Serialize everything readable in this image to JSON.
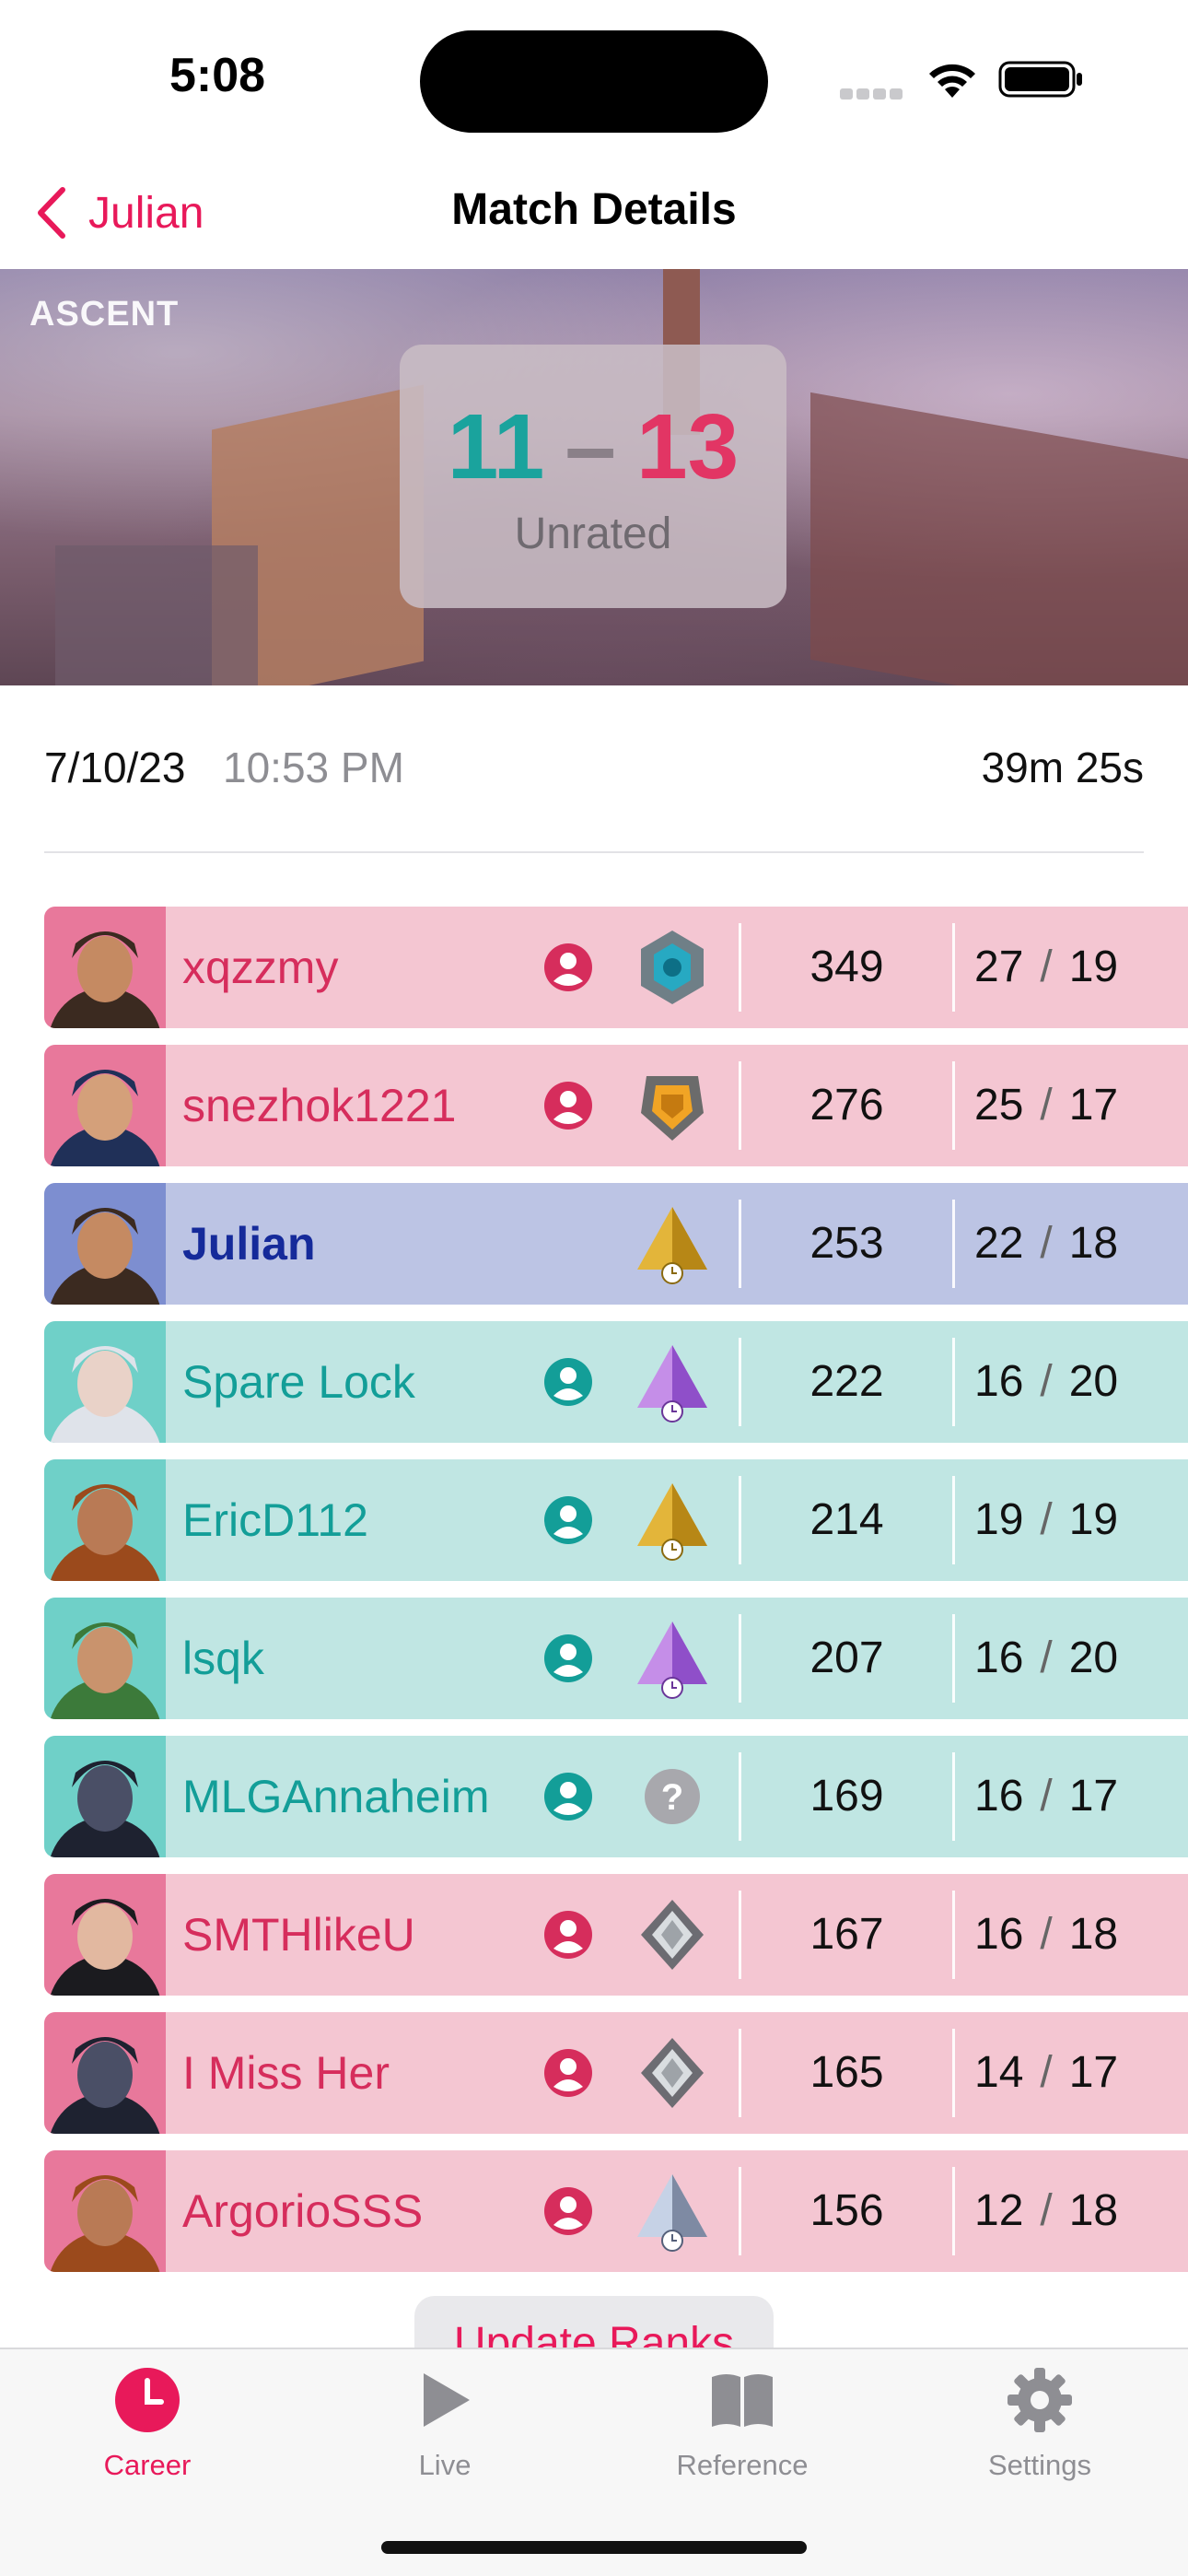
{
  "status_bar": {
    "time": "5:08"
  },
  "nav": {
    "back_label": "Julian",
    "title": "Match Details"
  },
  "hero": {
    "map_name": "ASCENT",
    "score_ally": "11",
    "score_dash": "–",
    "score_enemy": "13",
    "mode": "Unrated"
  },
  "meta": {
    "date": "7/10/23",
    "time": "10:53 PM",
    "duration": "39m 25s"
  },
  "colors": {
    "accent": "#e8195a",
    "ally": "#139e98",
    "enemy": "#d62d5c",
    "self": "#152a9a"
  },
  "players": [
    {
      "name": "xqzzmy",
      "team": "enemy",
      "rank_icon": "ascendant-rank-icon",
      "score": "349",
      "kills": "27",
      "deaths": "19",
      "profile": true
    },
    {
      "name": "snezhok1221",
      "team": "enemy",
      "rank_icon": "gold-rank-icon",
      "score": "276",
      "kills": "25",
      "deaths": "17",
      "profile": true
    },
    {
      "name": "Julian",
      "team": "self",
      "rank_icon": "gold-triangle-rank-icon",
      "score": "253",
      "kills": "22",
      "deaths": "18",
      "profile": false
    },
    {
      "name": "Spare Lock",
      "team": "ally",
      "rank_icon": "purple-triangle-rank-icon",
      "score": "222",
      "kills": "16",
      "deaths": "20",
      "profile": true
    },
    {
      "name": "EricD112",
      "team": "ally",
      "rank_icon": "gold-triangle-rank-icon",
      "score": "214",
      "kills": "19",
      "deaths": "19",
      "profile": true
    },
    {
      "name": "lsqk",
      "team": "ally",
      "rank_icon": "purple-triangle-rank-icon",
      "score": "207",
      "kills": "16",
      "deaths": "20",
      "profile": true
    },
    {
      "name": "MLGAnnaheim",
      "team": "ally",
      "rank_icon": "unknown-rank-icon",
      "score": "169",
      "kills": "16",
      "deaths": "17",
      "profile": true
    },
    {
      "name": "SMTHlikeU",
      "team": "enemy",
      "rank_icon": "silver-rank-icon",
      "score": "167",
      "kills": "16",
      "deaths": "18",
      "profile": true
    },
    {
      "name": "I Miss Her",
      "team": "enemy",
      "rank_icon": "silver-rank-icon",
      "score": "165",
      "kills": "14",
      "deaths": "17",
      "profile": true
    },
    {
      "name": "ArgorioSSS",
      "team": "enemy",
      "rank_icon": "silver-triangle-rank-icon",
      "score": "156",
      "kills": "12",
      "deaths": "18",
      "profile": true
    }
  ],
  "update_button": "Update Ranks",
  "tabs": [
    {
      "label": "Career",
      "icon": "clock-icon",
      "active": true
    },
    {
      "label": "Live",
      "icon": "play-icon",
      "active": false
    },
    {
      "label": "Reference",
      "icon": "book-icon",
      "active": false
    },
    {
      "label": "Settings",
      "icon": "gear-icon",
      "active": false
    }
  ]
}
